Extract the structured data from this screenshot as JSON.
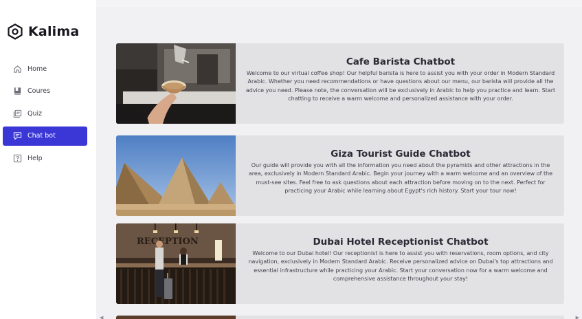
{
  "app": {
    "name": "Kalima"
  },
  "sidebar": {
    "items": [
      {
        "label": "Home",
        "icon": "home-icon",
        "active": false
      },
      {
        "label": "Coures",
        "icon": "book-icon",
        "active": false
      },
      {
        "label": "Quiz",
        "icon": "quiz-icon",
        "active": false
      },
      {
        "label": "Chat bot",
        "icon": "chat-icon",
        "active": true
      },
      {
        "label": "Help",
        "icon": "help-icon",
        "active": false
      }
    ]
  },
  "chatbots": [
    {
      "title": "Cafe Barista Chatbot",
      "image": "barista-pouring-latte",
      "description": "Welcome to our virtual coffee shop! Our helpful barista is here to assist you with your order in Modern Standard Arabic. Whether you need recommendations or have questions about our menu, our barista will provide all the advice you need. Please note, the conversation will be exclusively in Arabic to help you practice and learn. Start chatting to receive a warm welcome and personalized assistance with your order."
    },
    {
      "title": "Giza Tourist Guide Chatbot",
      "image": "giza-pyramids",
      "description": "Our guide will provide you with all the information you need about the pyramids and other attractions in the area, exclusively in Modern Standard Arabic. Begin your journey with a warm welcome and an overview of the must-see sites. Feel free to ask questions about each attraction before moving on to the next. Perfect for practicing your Arabic while learning about Egypt's rich history. Start your tour now!"
    },
    {
      "title": "Dubai Hotel Receptionist Chatbot",
      "image": "hotel-reception-desk",
      "description": "Welcome to our Dubai hotel! Our receptionist is here to assist you with reservations, room options, and city navigation, exclusively in Modern Standard Arabic. Receive personalized advice on Dubai's top attractions and essential infrastructure while practicing your Arabic. Start your conversation now for a warm welcome and comprehensive assistance throughout your stay!"
    }
  ],
  "reception_sign": "RECEPTION",
  "colors": {
    "accent": "#3b37d6",
    "card_bg": "#e2e1e3",
    "page_bg": "#f1f1f3"
  }
}
